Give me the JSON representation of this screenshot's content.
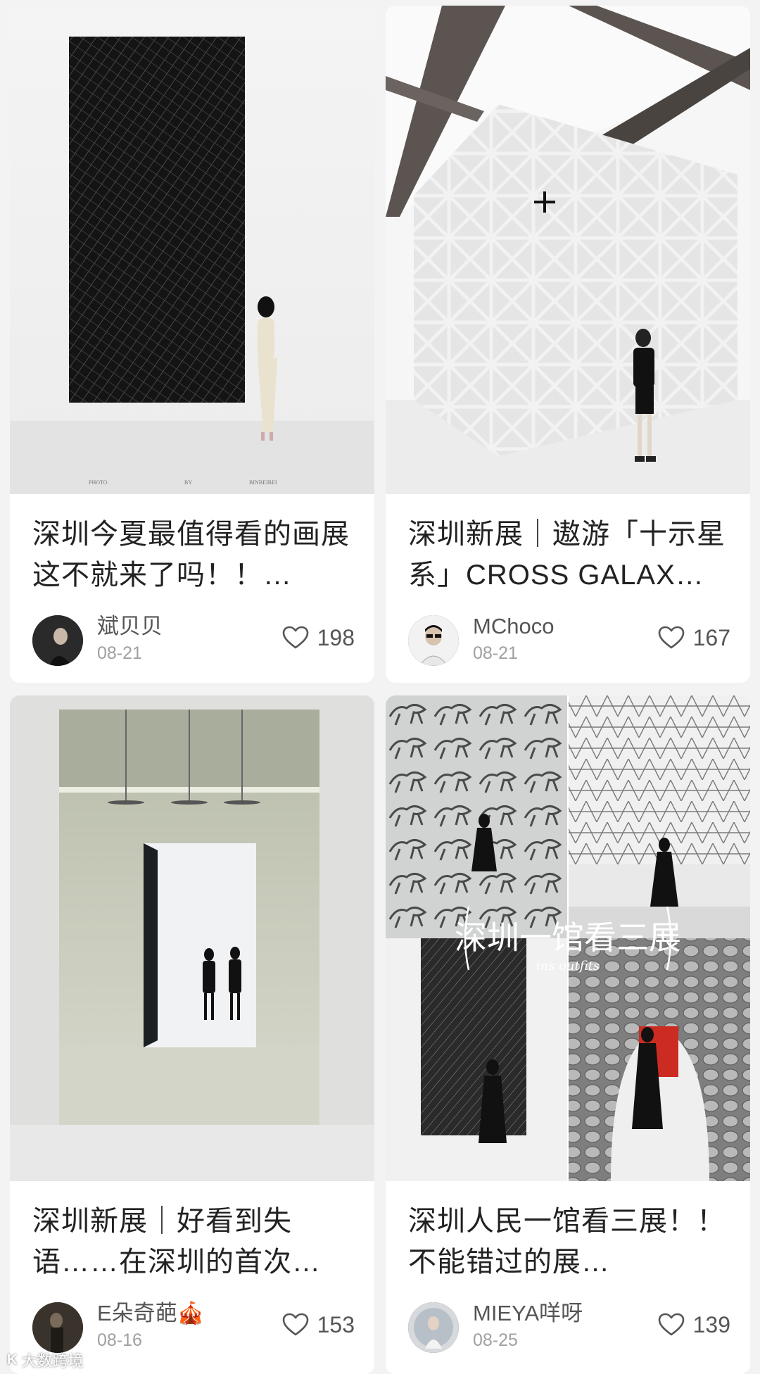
{
  "feed": {
    "posts": [
      {
        "title": "深圳今夏最值得看的画展这不就来了吗！！…",
        "author": "斌贝贝",
        "date": "08-21",
        "likes": "198",
        "photo_credit": [
          "PHOTO",
          "BY",
          "BINBEIBEI"
        ]
      },
      {
        "title": "深圳新展｜遨游「十示星系」CROSS GALAX…",
        "author": "MChoco",
        "date": "08-21",
        "likes": "167"
      },
      {
        "title": "深圳新展｜好看到失语……在深圳的首次…",
        "author": "E朵奇葩🎪",
        "date": "08-16",
        "likes": "153"
      },
      {
        "title": "深圳人民一馆看三展！！不能错过的展…",
        "author": "MIEYA咩呀",
        "date": "08-25",
        "likes": "139",
        "cover_text": "深圳一馆看三展",
        "cover_script": "ins outfits"
      }
    ]
  },
  "watermark": {
    "logo": "K",
    "text": "大数跨境"
  },
  "icons": {
    "like": "heart-outline-icon"
  },
  "colors": {
    "background": "#f3f3f3",
    "card": "#ffffff",
    "title_text": "#222222",
    "meta_text": "#a0a0a0"
  }
}
